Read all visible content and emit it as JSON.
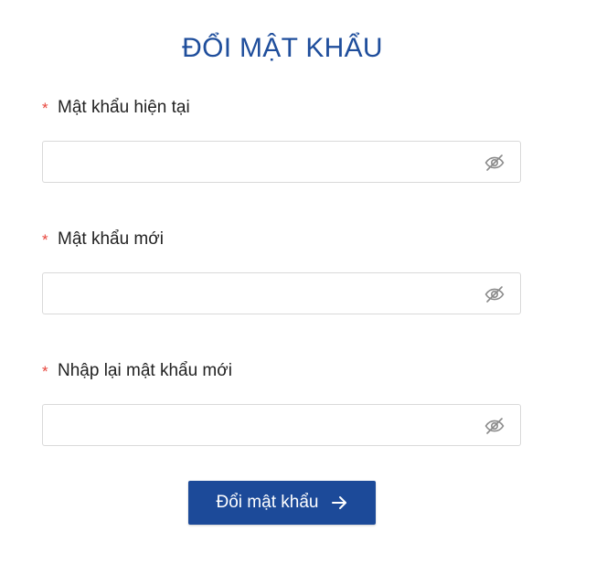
{
  "page": {
    "title": "ĐỔI MẬT KHẨU"
  },
  "form": {
    "required_marker": "*",
    "fields": [
      {
        "label": "Mật khẩu hiện tại",
        "value": "",
        "placeholder": "",
        "toggle_icon": "eye-slash-icon"
      },
      {
        "label": "Mật khẩu mới",
        "value": "",
        "placeholder": "",
        "toggle_icon": "eye-slash-icon"
      },
      {
        "label": "Nhập lại mật khẩu mới",
        "value": "",
        "placeholder": "",
        "toggle_icon": "eye-slash-icon"
      }
    ],
    "submit": {
      "label": "Đổi mật khẩu",
      "icon": "arrow-right-icon"
    }
  },
  "colors": {
    "title": "#1f4e9c",
    "required": "#e8453c",
    "button_bg": "#1c4a99",
    "icon": "#8a8a8a"
  }
}
